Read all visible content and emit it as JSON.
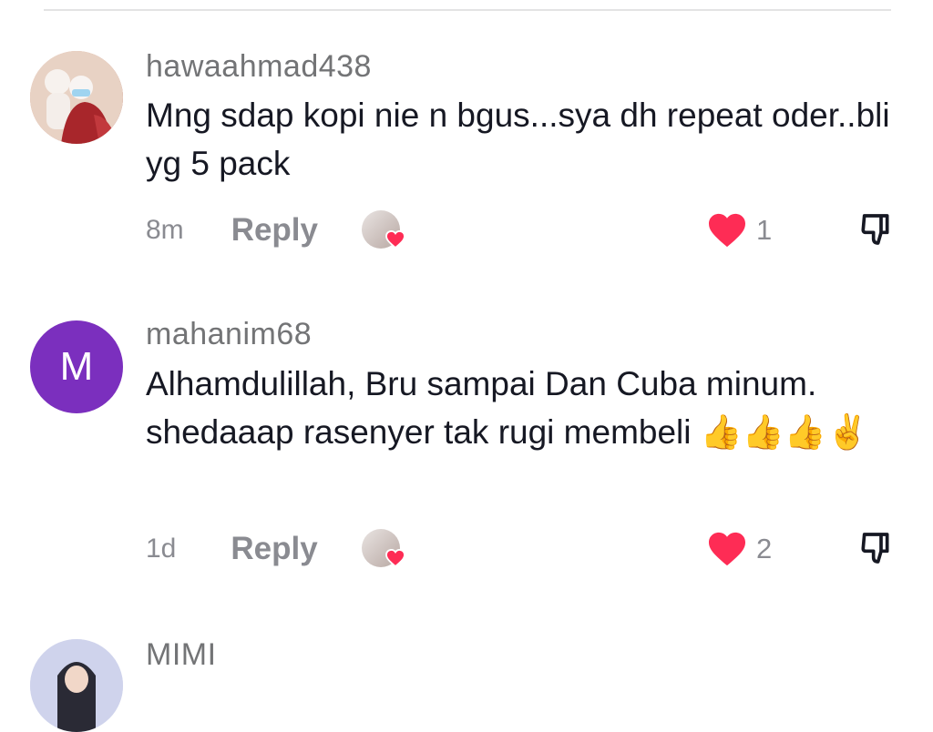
{
  "comments": [
    {
      "username": "hawaahmad438",
      "text": "Mng sdap kopi nie n bgus...sya dh repeat oder..bli yg 5 pack",
      "time": "8m",
      "reply_label": "Reply",
      "likes": "1",
      "avatar": "photo"
    },
    {
      "username": "mahanim68",
      "text": "Alhamdulillah, Bru sampai Dan Cuba minum. shedaaap rasenyer tak rugi membeli 👍👍👍✌️",
      "time": "1d",
      "reply_label": "Reply",
      "likes": "2",
      "avatar_letter": "M"
    },
    {
      "username": "MIMI",
      "avatar": "photo"
    }
  ],
  "colors": {
    "heart": "#fe2c55",
    "avatar_letter_bg": "#7b2fbe",
    "muted_text": "#8a8b91"
  }
}
